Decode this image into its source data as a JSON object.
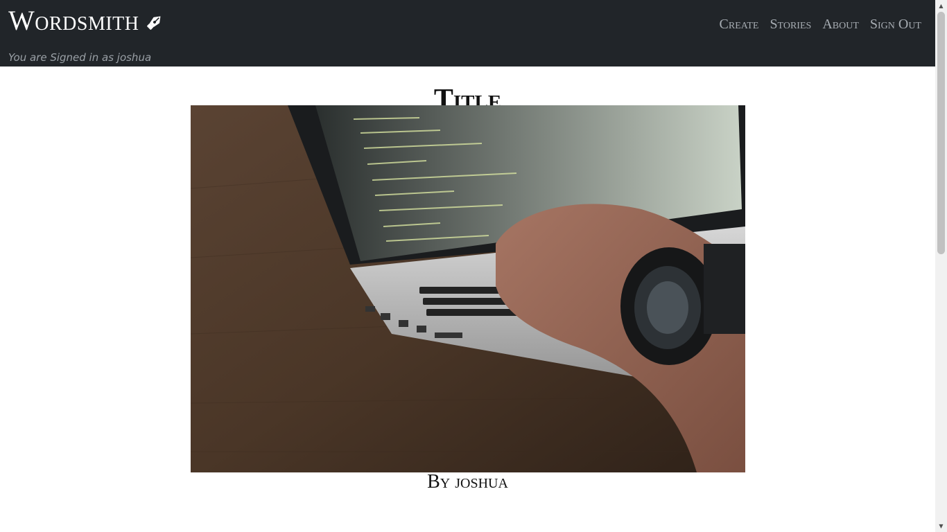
{
  "nav": {
    "brand": "Wordsmith",
    "signed_in_text": "You are Signed in as joshua",
    "links": {
      "create": "Create",
      "stories": "Stories",
      "about": "About",
      "sign_out": "Sign Out"
    }
  },
  "story": {
    "title": "Title",
    "byline": "By joshua",
    "image_subject": "laptop-coding-photo"
  },
  "colors": {
    "navbar_bg": "#212529",
    "nav_link": "#a7adb3",
    "brand": "#ffffff"
  }
}
